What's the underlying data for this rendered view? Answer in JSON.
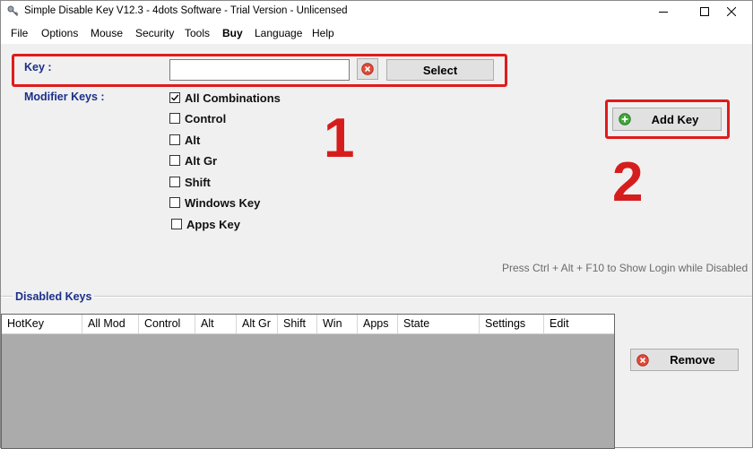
{
  "window": {
    "title": "Simple Disable Key V12.3 - 4dots Software - Trial Version - Unlicensed",
    "app_icon": "key-icon",
    "controls": [
      "minimize-icon",
      "maximize-icon",
      "close-icon"
    ]
  },
  "menu": {
    "items": [
      "File",
      "Options",
      "Mouse",
      "Security",
      "Tools",
      "Buy",
      "Language",
      "Help"
    ]
  },
  "key": {
    "label": "Key :",
    "value": "",
    "clear_icon": "clear-icon",
    "select_label": "Select"
  },
  "modifiers": {
    "label": "Modifier Keys :",
    "options": [
      {
        "label": "All Combinations",
        "checked": true
      },
      {
        "label": "Control",
        "checked": false
      },
      {
        "label": "Alt",
        "checked": false
      },
      {
        "label": "Alt Gr",
        "checked": false
      },
      {
        "label": "Shift",
        "checked": false
      },
      {
        "label": "Windows Key",
        "checked": false
      },
      {
        "label": "Apps Key",
        "checked": false
      }
    ]
  },
  "add_key": {
    "label": "Add Key",
    "icon": "add-icon"
  },
  "annotations": {
    "step1": "1",
    "step2": "2",
    "color": "#d61d1d"
  },
  "hint": "Press Ctrl + Alt + F10 to Show Login while Disabled",
  "disabled_keys": {
    "title": "Disabled Keys",
    "columns": [
      "HotKey",
      "All Mod",
      "Control",
      "Alt",
      "Alt Gr",
      "Shift",
      "Win",
      "Apps",
      "State",
      "Settings",
      "Edit"
    ],
    "rows": []
  },
  "remove": {
    "label": "Remove",
    "icon": "remove-icon"
  },
  "colors": {
    "label_blue": "#1a2f8a",
    "highlight_red": "#e01b1b",
    "grid_empty": "#ababab"
  }
}
